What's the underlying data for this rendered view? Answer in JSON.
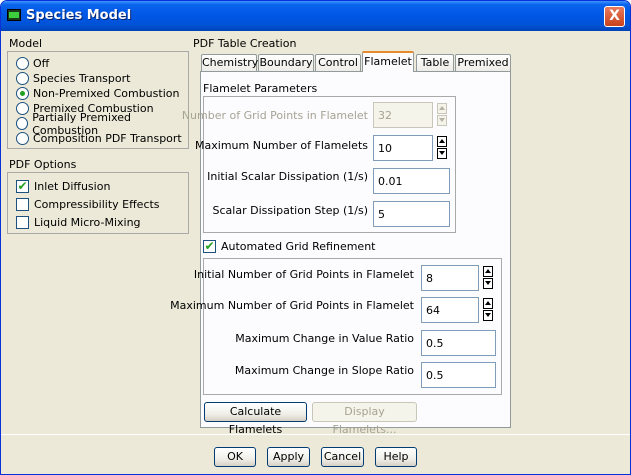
{
  "window": {
    "title": "Species Model",
    "close_label": "X"
  },
  "model": {
    "label": "Model",
    "options": [
      {
        "label": "Off",
        "selected": false
      },
      {
        "label": "Species Transport",
        "selected": false
      },
      {
        "label": "Non-Premixed Combustion",
        "selected": true
      },
      {
        "label": "Premixed Combustion",
        "selected": false
      },
      {
        "label": "Partially Premixed Combustion",
        "selected": false
      },
      {
        "label": "Composition PDF Transport",
        "selected": false
      }
    ]
  },
  "pdf_options": {
    "label": "PDF Options",
    "options": [
      {
        "label": "Inlet Diffusion",
        "checked": true
      },
      {
        "label": "Compressibility Effects",
        "checked": false
      },
      {
        "label": "Liquid Micro-Mixing",
        "checked": false
      }
    ]
  },
  "pdf_table": {
    "label": "PDF Table Creation",
    "tabs": [
      "Chemistry",
      "Boundary",
      "Control",
      "Flamelet",
      "Table",
      "Premixed"
    ],
    "active_tab": "Flamelet"
  },
  "flamelet": {
    "params_label": "Flamelet Parameters",
    "grid_points_label": "Number of Grid Points in Flamelet",
    "grid_points_value": "32",
    "max_flamelets_label": "Maximum Number of Flamelets",
    "max_flamelets_value": "10",
    "initial_dissipation_label": "Initial Scalar Dissipation (1/s)",
    "initial_dissipation_value": "0.01",
    "dissipation_step_label": "Scalar Dissipation Step (1/s)",
    "dissipation_step_value": "5",
    "auto_refine_label": "Automated Grid Refinement",
    "auto_refine_checked": true,
    "initial_grid_label": "Initial Number of Grid Points in Flamelet",
    "initial_grid_value": "8",
    "max_grid_label": "Maximum Number of Grid Points in Flamelet",
    "max_grid_value": "64",
    "max_value_ratio_label": "Maximum Change in Value Ratio",
    "max_value_ratio_value": "0.5",
    "max_slope_ratio_label": "Maximum Change in Slope Ratio",
    "max_slope_ratio_value": "0.5",
    "calculate_label": "Calculate Flamelets",
    "display_label": "Display Flamelets..."
  },
  "footer": {
    "ok": "OK",
    "apply": "Apply",
    "cancel": "Cancel",
    "help": "Help"
  },
  "check_glyph": "✔"
}
